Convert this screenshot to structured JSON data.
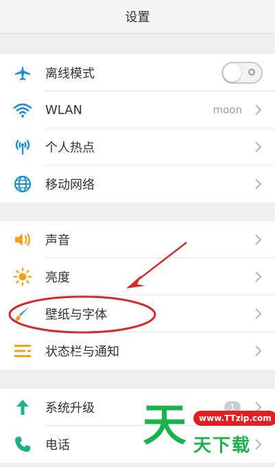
{
  "header": {
    "title": "设置"
  },
  "groups": [
    {
      "items": [
        {
          "label": "离线模式",
          "control": "toggle"
        },
        {
          "label": "WLAN",
          "value": "moon"
        },
        {
          "label": "个人热点"
        },
        {
          "label": "移动网络"
        }
      ]
    },
    {
      "items": [
        {
          "label": "声音"
        },
        {
          "label": "亮度"
        },
        {
          "label": "壁纸与字体"
        },
        {
          "label": "状态栏与通知"
        }
      ]
    },
    {
      "items": [
        {
          "label": "系统升级",
          "badge": "1"
        },
        {
          "label": "电话"
        }
      ]
    }
  ],
  "watermark": {
    "big": "天",
    "site": "www.TTzip.com",
    "text": "天下载"
  },
  "colors": {
    "blue_icon": "#1a8fd6",
    "orange_icon": "#f5a21b",
    "teal_icon": "#19b38a",
    "annotation_red": "#d42a2a"
  }
}
